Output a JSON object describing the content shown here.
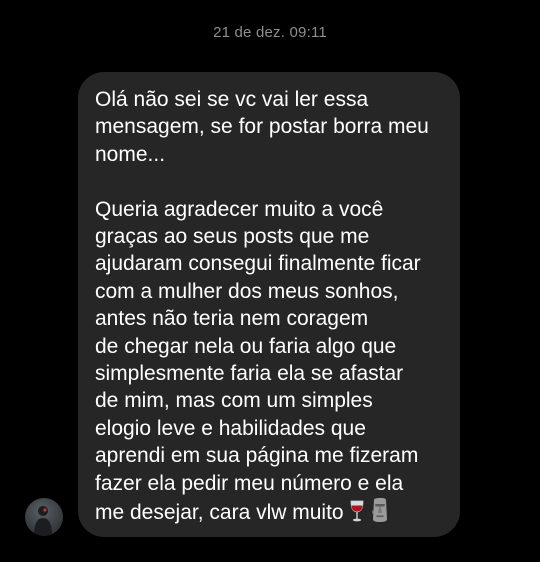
{
  "chat": {
    "timestamp": "21 de dez. 09:11",
    "message": {
      "paragraph_1": "Olá não sei se vc vai ler essa\nmensagem, se for postar borra meu\nnome...",
      "paragraph_2": "Queria agradecer muito a você\ngraças ao seus posts que me\najudaram consegui finalmente ficar\ncom a mulher dos meus sonhos,\nantes não teria nem coragem\nde chegar nela ou faria algo que\nsimplesmente faria ela se afastar\nde mim, mas com um simples\nelogio leve e habilidades que\naprendi em sua página me fizeram\nfazer ela pedir meu número e ela\nme desejar, cara vlw muito",
      "emojis": [
        "wine-glass-icon",
        "moai-icon"
      ]
    }
  },
  "colors": {
    "background": "#000000",
    "bubble": "#262626",
    "text": "#ffffff",
    "timestamp": "#8e8e8e"
  }
}
